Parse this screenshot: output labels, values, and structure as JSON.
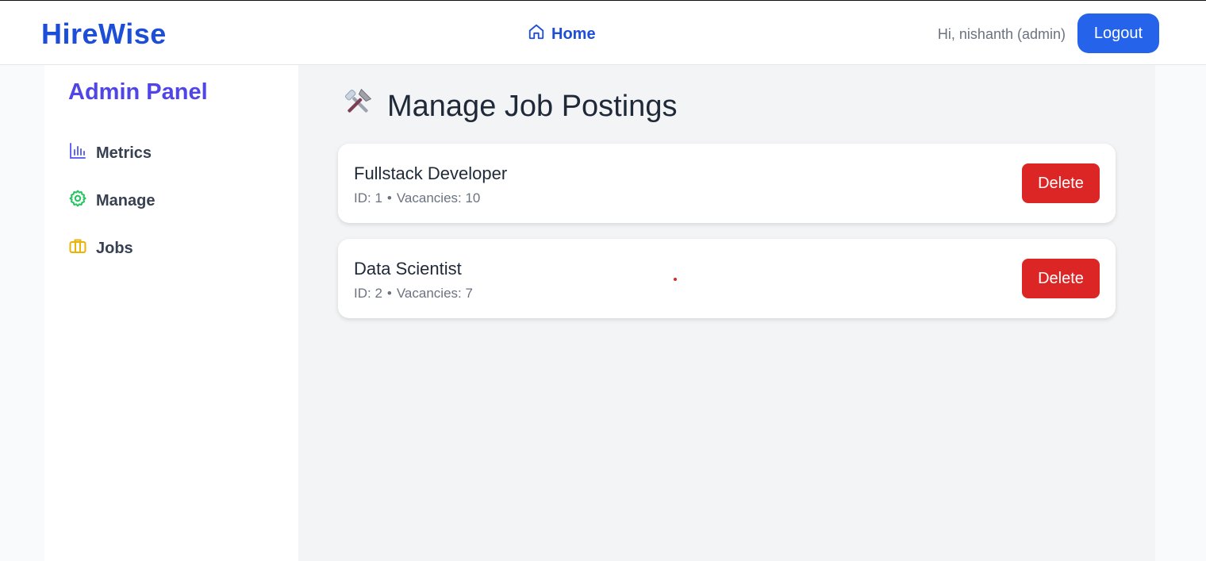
{
  "header": {
    "logo": "HireWise",
    "nav_home": "Home",
    "greeting": "Hi, nishanth (admin)",
    "logout": "Logout"
  },
  "sidebar": {
    "title": "Admin Panel",
    "items": [
      {
        "label": "Metrics",
        "icon": "bar-chart-icon",
        "color": "#6366f1"
      },
      {
        "label": "Manage",
        "icon": "gear-icon",
        "color": "#22c55e"
      },
      {
        "label": "Jobs",
        "icon": "briefcase-icon",
        "color": "#eab308"
      }
    ]
  },
  "main": {
    "title": "Manage Job Postings",
    "title_icon": "hammer-wrench-icon",
    "jobs": [
      {
        "title": "Fullstack Developer",
        "id_text": "ID: 1",
        "separator": "•",
        "vacancies_text": "Vacancies: 10",
        "delete_label": "Delete"
      },
      {
        "title": "Data Scientist",
        "id_text": "ID: 2",
        "separator": "•",
        "vacancies_text": "Vacancies: 7",
        "delete_label": "Delete"
      }
    ]
  },
  "colors": {
    "brand": "#1d4ed8",
    "primary_button": "#2563eb",
    "danger": "#dc2626",
    "sidebar_title": "#4f46e5"
  }
}
